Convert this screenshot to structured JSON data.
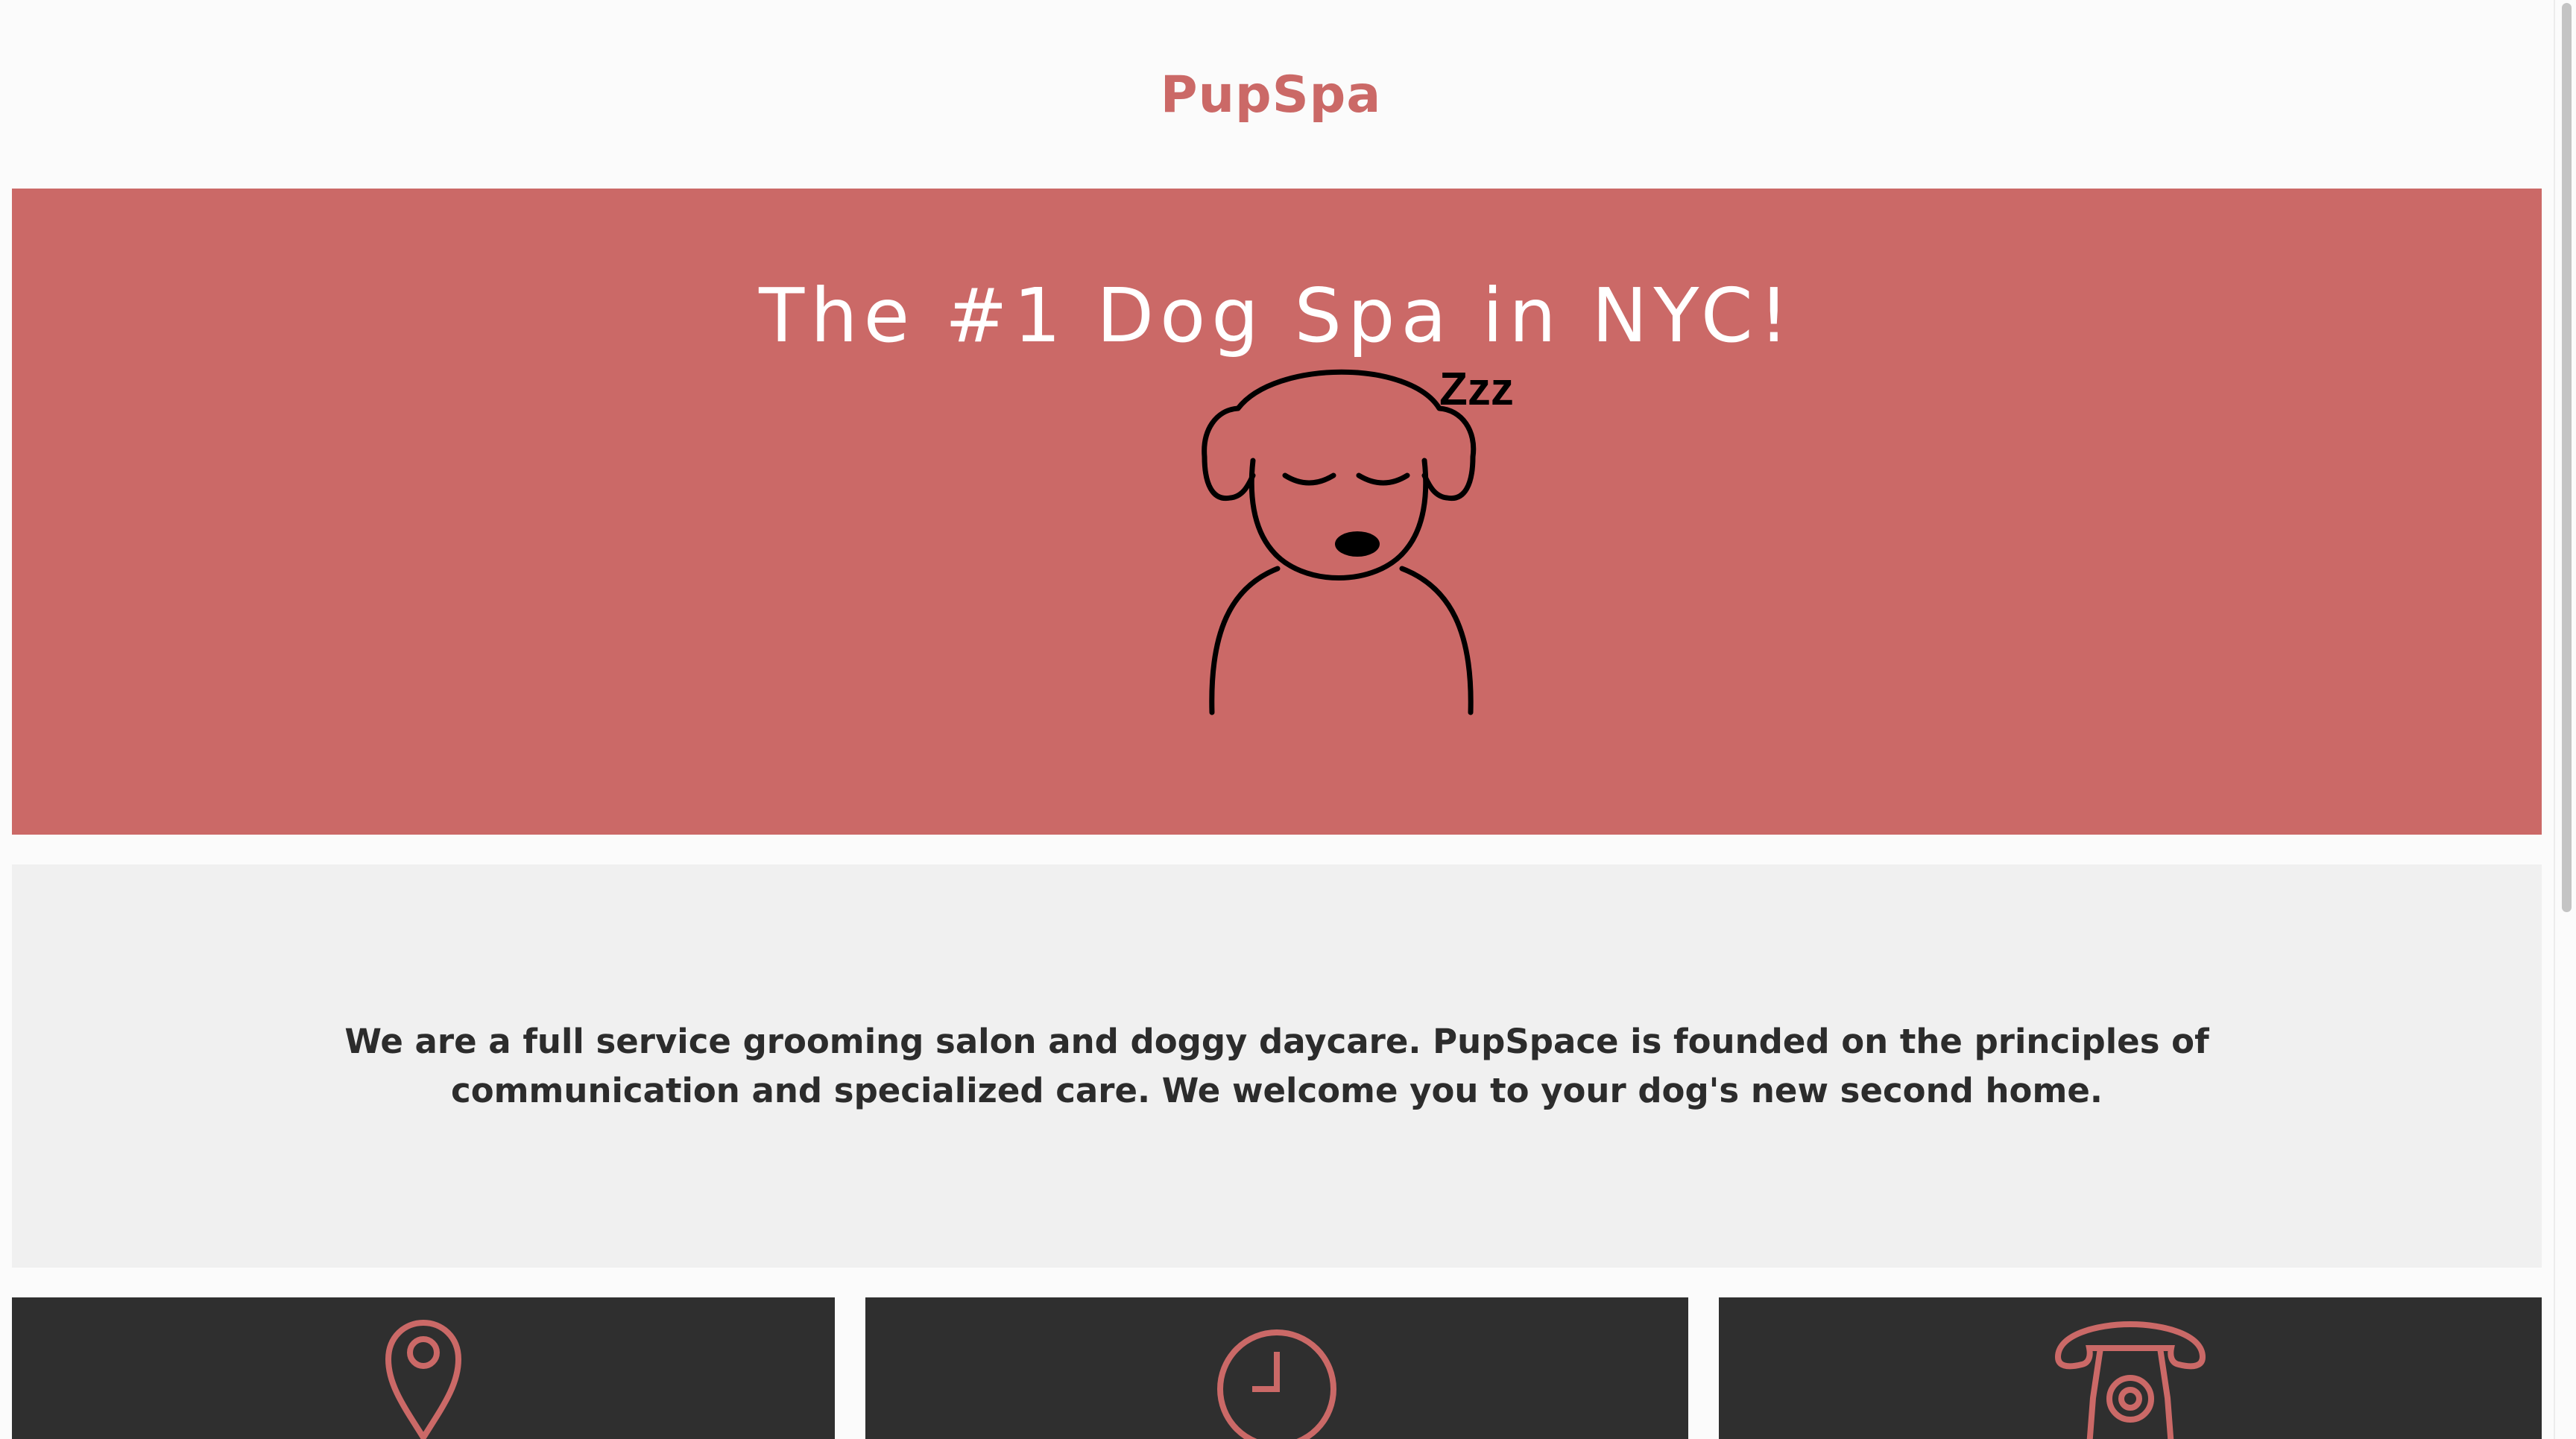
{
  "header": {
    "brand": "PupSpa"
  },
  "hero": {
    "title": "The #1 Dog Spa in NYC!",
    "sleep_text": "Zzz",
    "illustration": "sleeping-dog-illustration"
  },
  "about": {
    "text": "We are a full service grooming salon and doggy daycare. PupSpace is founded on the principles of communication and specialized care. We welcome you to your dog's new second home."
  },
  "cards": [
    {
      "icon": "location-pin-icon"
    },
    {
      "icon": "clock-icon"
    },
    {
      "icon": "telephone-icon"
    }
  ],
  "colors": {
    "accent": "#cb6967",
    "dark_card": "#2f2f2f",
    "about_bg": "#f0f0f0",
    "page_bg": "#fbfbfb"
  }
}
